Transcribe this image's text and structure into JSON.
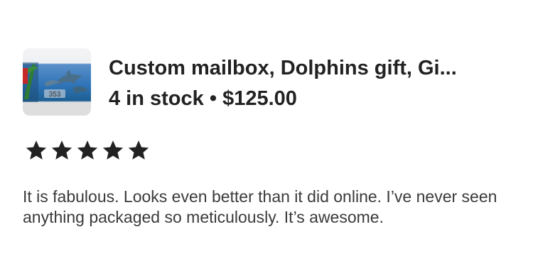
{
  "listing": {
    "title": "Custom mailbox, Dolphins gift, Gi...",
    "stock": "4 in stock",
    "separator": "•",
    "price": "$125.00",
    "thumbnail": {
      "label": "353",
      "icon": "dolphin-mailbox-photo"
    }
  },
  "review": {
    "rating": 5,
    "rating_max": 5,
    "star_icon": "star-icon",
    "star_color": "#222222",
    "text": "It is fabulous. Looks even better than it did online. I’ve never seen anything packaged so meticulously. It’s awesome."
  }
}
